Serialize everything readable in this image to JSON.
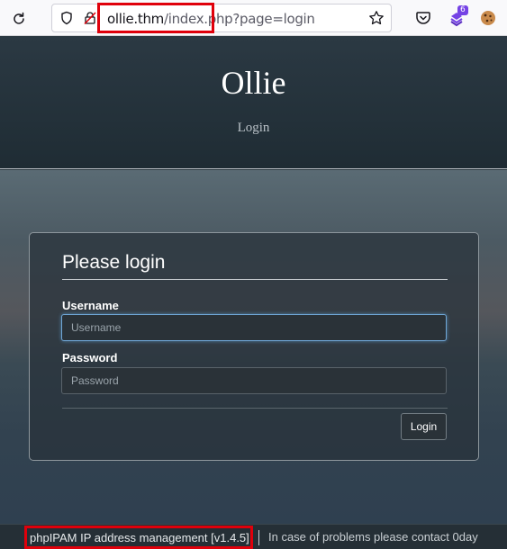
{
  "browser": {
    "url_host": "ollie.thm",
    "url_path": "/index.php?page=login",
    "extension_badge": "6"
  },
  "header": {
    "title": "Ollie",
    "subtitle": "Login"
  },
  "login": {
    "heading": "Please login",
    "username_label": "Username",
    "username_placeholder": "Username",
    "username_value": "",
    "password_label": "Password",
    "password_placeholder": "Password",
    "password_value": "",
    "button_label": "Login"
  },
  "footer": {
    "version_text": "phpIPAM IP address management [v1.4.5]",
    "contact_text": "In case of problems please contact 0day"
  },
  "colors": {
    "highlight": "#e0000b",
    "header_bg": "#24323b",
    "card_border": "#8e979d"
  }
}
